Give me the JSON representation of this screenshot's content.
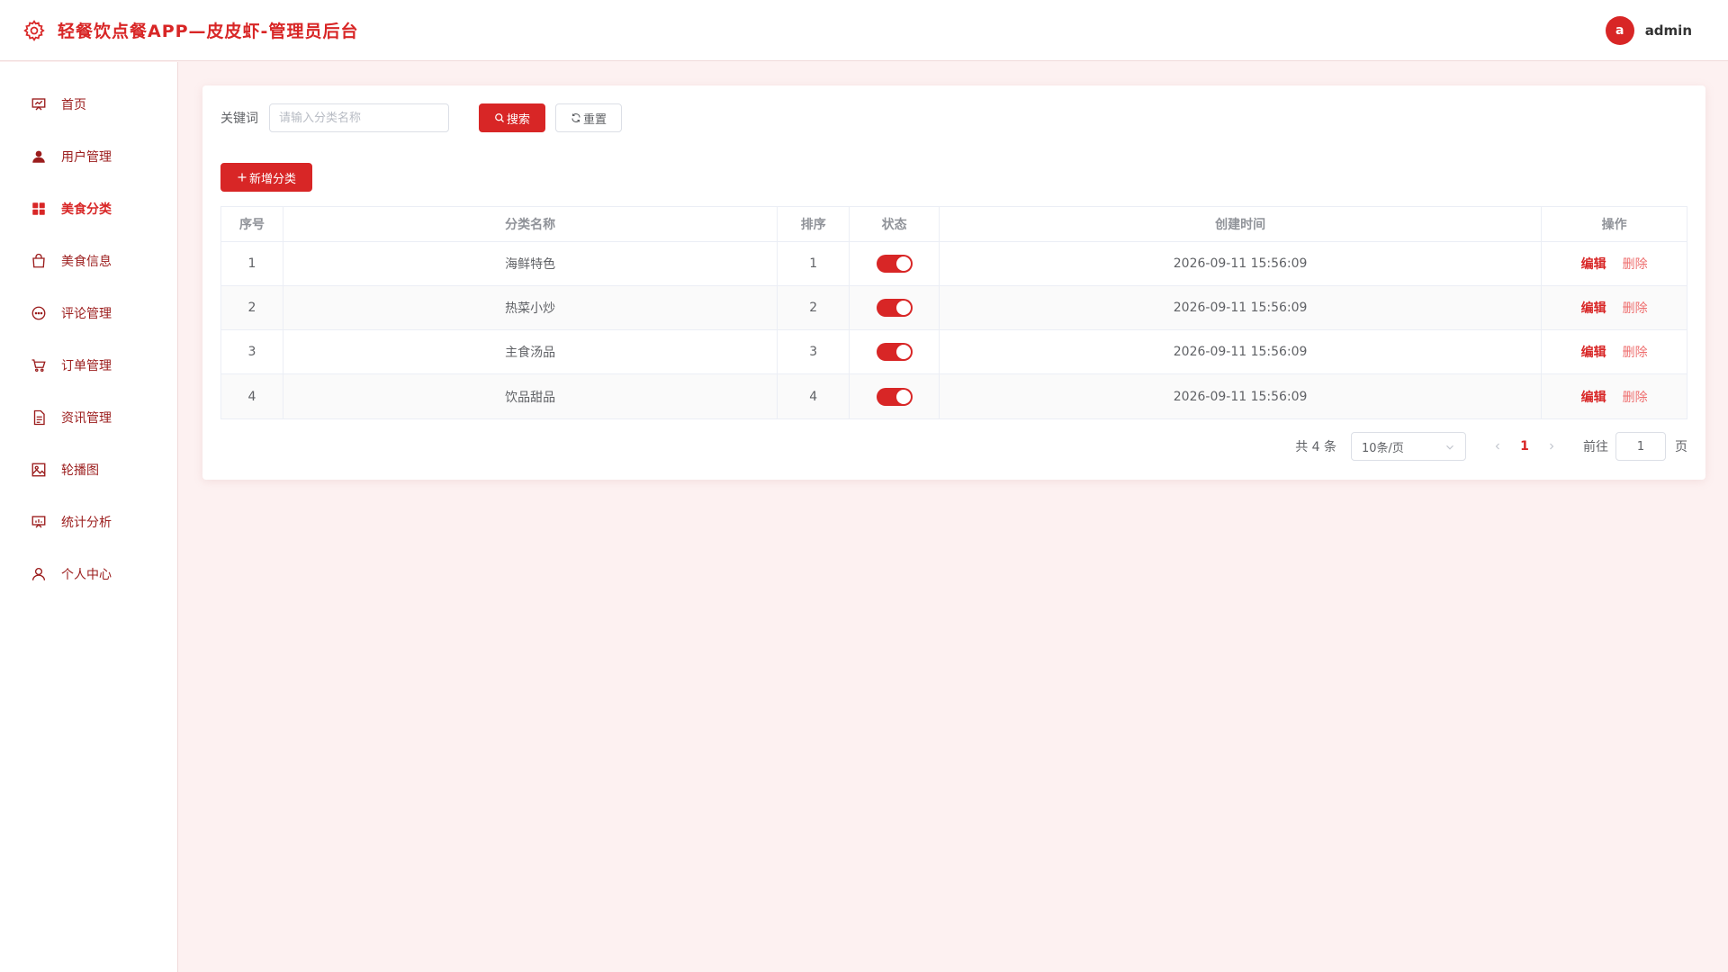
{
  "header": {
    "title": "轻餐饮点餐APP—皮皮虾-管理员后台",
    "avatar_letter": "a",
    "username": "admin",
    "accent_color": "#d82626"
  },
  "sidebar": {
    "items": [
      {
        "label": "首页",
        "icon": "dashboard-icon",
        "active": false
      },
      {
        "label": "用户管理",
        "icon": "user-icon",
        "active": false
      },
      {
        "label": "美食分类",
        "icon": "grid-icon",
        "active": true
      },
      {
        "label": "美食信息",
        "icon": "bag-icon",
        "active": false
      },
      {
        "label": "评论管理",
        "icon": "comment-icon",
        "active": false
      },
      {
        "label": "订单管理",
        "icon": "cart-icon",
        "active": false
      },
      {
        "label": "资讯管理",
        "icon": "document-icon",
        "active": false
      },
      {
        "label": "轮播图",
        "icon": "image-icon",
        "active": false
      },
      {
        "label": "统计分析",
        "icon": "chart-icon",
        "active": false
      },
      {
        "label": "个人中心",
        "icon": "person-icon",
        "active": false
      }
    ]
  },
  "search": {
    "label": "关键词",
    "placeholder": "请输入分类名称",
    "value": "",
    "search_button": "搜索",
    "reset_button": "重置"
  },
  "toolbar": {
    "add_button": "新增分类"
  },
  "table": {
    "columns": [
      "序号",
      "分类名称",
      "排序",
      "状态",
      "创建时间",
      "操作"
    ],
    "rows": [
      {
        "index": "1",
        "name": "海鲜特色",
        "sort": "1",
        "status": true,
        "created": "2026-09-11 15:56:09"
      },
      {
        "index": "2",
        "name": "热菜小炒",
        "sort": "2",
        "status": true,
        "created": "2026-09-11 15:56:09"
      },
      {
        "index": "3",
        "name": "主食汤品",
        "sort": "3",
        "status": true,
        "created": "2026-09-11 15:56:09"
      },
      {
        "index": "4",
        "name": "饮品甜品",
        "sort": "4",
        "status": true,
        "created": "2026-09-11 15:56:09"
      }
    ],
    "edit_label": "编辑",
    "delete_label": "删除"
  },
  "pagination": {
    "total_text": "共 4 条",
    "page_size": "10条/页",
    "current_page": "1",
    "goto_label": "前往",
    "jump_value": "1",
    "page_suffix": "页"
  }
}
